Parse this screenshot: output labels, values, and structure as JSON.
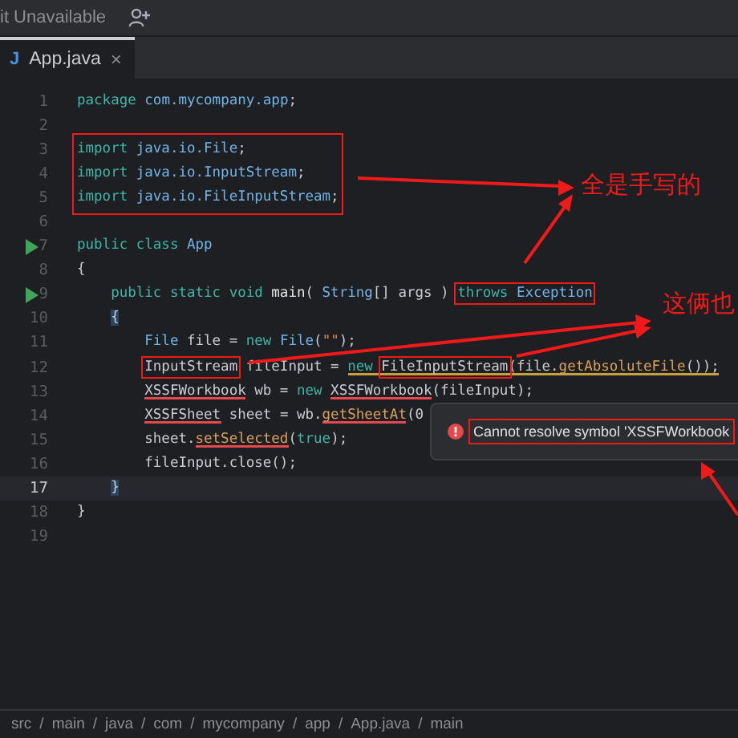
{
  "top_bar": {
    "label": "it Unavailable"
  },
  "tabs": [
    {
      "label": "App.java",
      "icon": "J",
      "close": "×",
      "selected": true
    }
  ],
  "editor": {
    "lines": [
      {
        "number": "1",
        "current": false,
        "boxed": false,
        "tokens": [
          {
            "text": "package",
            "kind": "keyword"
          },
          {
            "text": " com.mycompany.app",
            "kind": "type"
          },
          {
            "text": ";",
            "kind": "plain"
          }
        ]
      },
      {
        "number": "2",
        "current": false,
        "boxed": false
      },
      {
        "number": "3",
        "current": false,
        "boxed": true,
        "tokens": [
          {
            "text": "import",
            "kind": "keyword"
          },
          {
            "text": " java.io.File",
            "kind": "type"
          },
          {
            "text": ";",
            "kind": "plain"
          }
        ]
      },
      {
        "number": "4",
        "current": false,
        "boxed": true,
        "tokens": [
          {
            "text": "import",
            "kind": "keyword"
          },
          {
            "text": " java.io.InputStream",
            "kind": "type"
          },
          {
            "text": ";",
            "kind": "plain"
          }
        ]
      },
      {
        "number": "5",
        "current": false,
        "boxed": true,
        "tokens": [
          {
            "text": "import",
            "kind": "keyword"
          },
          {
            "text": " java.io.FileInputStream",
            "kind": "type"
          },
          {
            "text": ";",
            "kind": "plain"
          }
        ]
      },
      {
        "number": "6",
        "current": false,
        "boxed": false
      },
      {
        "number": "7",
        "current": false,
        "boxed": false,
        "run": true,
        "tokens": [
          {
            "text": "public class",
            "kind": "keyword"
          },
          {
            "text": " App",
            "kind": "type"
          }
        ]
      },
      {
        "number": "8",
        "current": false,
        "boxed": false,
        "tokens": [
          {
            "text": "{",
            "kind": "plain"
          }
        ],
        "children": [
          {
            "number": "9",
            "current": false,
            "boxed": false,
            "run": true,
            "tokens": [
              {
                "text": "public static void",
                "kind": "keyword"
              },
              {
                "text": " main",
                "kind": "name"
              },
              {
                "text": "(",
                "kind": "plain"
              },
              {
                "text": " String",
                "kind": "type"
              },
              {
                "text": "[] args ) ",
                "kind": "plain"
              },
              {
                "text": "throws",
                "kind": "keyword",
                "boxed": true
              },
              {
                "text": " Exception",
                "kind": "type",
                "boxed": true
              }
            ]
          },
          {
            "number": "10",
            "current": false,
            "boxed": false,
            "tokens": [
              {
                "text": "{",
                "kind": "plain",
                "matched": true
              }
            ],
            "children": [
              {
                "number": "11",
                "current": false,
                "boxed": false,
                "tokens": [
                  {
                    "text": "File",
                    "kind": "type"
                  },
                  {
                    "text": " file = ",
                    "kind": "plain"
                  },
                  {
                    "text": "new",
                    "kind": "keyword"
                  },
                  {
                    "text": " File",
                    "kind": "type"
                  },
                  {
                    "text": "(",
                    "kind": "plain"
                  },
                  {
                    "text": "\"\"",
                    "kind": "string"
                  },
                  {
                    "text": ");",
                    "kind": "plain"
                  }
                ]
              },
              {
                "number": "12",
                "current": false,
                "boxed": false,
                "tokens": [
                  {
                    "text": "InputStream",
                    "kind": "plain",
                    "boxed": true
                  },
                  {
                    "text": " fileInput = ",
                    "kind": "plain"
                  },
                  {
                    "text": "new ",
                    "kind": "keyword",
                    "warning": true
                  },
                  {
                    "text": "FileInputStream",
                    "kind": "plain",
                    "warning": true,
                    "boxed": true
                  },
                  {
                    "text": "(file.",
                    "kind": "plain",
                    "warning": true
                  },
                  {
                    "text": "getAbsoluteFile",
                    "kind": "method",
                    "warning": true
                  },
                  {
                    "text": "());",
                    "kind": "plain",
                    "warning": true
                  }
                ]
              },
              {
                "number": "13",
                "current": false,
                "boxed": false,
                "tokens": [
                  {
                    "text": "XSSFWorkbook",
                    "kind": "plain",
                    "error": true
                  },
                  {
                    "text": " wb = ",
                    "kind": "plain"
                  },
                  {
                    "text": "new ",
                    "kind": "keyword"
                  },
                  {
                    "text": "XSSFWorkbook",
                    "kind": "plain",
                    "error": true
                  },
                  {
                    "text": "(fileInput);",
                    "kind": "plain"
                  }
                ]
              },
              {
                "number": "14",
                "current": false,
                "boxed": false,
                "tokens": [
                  {
                    "text": "XSSFSheet",
                    "kind": "plain",
                    "error": true
                  },
                  {
                    "text": " sheet = wb.",
                    "kind": "plain"
                  },
                  {
                    "text": "getSheetAt",
                    "kind": "method",
                    "error": true
                  },
                  {
                    "text": "(0",
                    "kind": "plain"
                  }
                ]
              },
              {
                "number": "15",
                "current": false,
                "boxed": false,
                "tokens": [
                  {
                    "text": "sheet.",
                    "kind": "plain"
                  },
                  {
                    "text": "setSelected",
                    "kind": "method",
                    "error": true
                  },
                  {
                    "text": "(",
                    "kind": "plain"
                  },
                  {
                    "text": "true",
                    "kind": "keyword"
                  },
                  {
                    "text": ");",
                    "kind": "plain"
                  }
                ]
              },
              {
                "number": "16",
                "current": false,
                "boxed": false,
                "tokens": [
                  {
                    "text": "fileInput.close();",
                    "kind": "plain"
                  }
                ]
              }
            ]
          },
          {
            "number": "17",
            "current": true,
            "boxed": false,
            "tokens": [
              {
                "text": "}",
                "kind": "plain",
                "matched": true
              }
            ]
          }
        ]
      },
      {
        "number": "18",
        "current": false,
        "boxed": false,
        "tokens": [
          {
            "text": "}",
            "kind": "plain"
          }
        ]
      },
      {
        "number": "19",
        "current": false,
        "boxed": false
      }
    ]
  },
  "popup": {
    "message": "Cannot resolve symbol 'XSSFWorkbook",
    "boxed": true
  },
  "callouts": [
    {
      "text": "全是手写的"
    },
    {
      "text": "这俩也"
    }
  ],
  "breadcrumb": {
    "separator": "/",
    "items": [
      "src",
      "main",
      "java",
      "com",
      "mycompany",
      "app",
      "App.java",
      "main"
    ]
  }
}
